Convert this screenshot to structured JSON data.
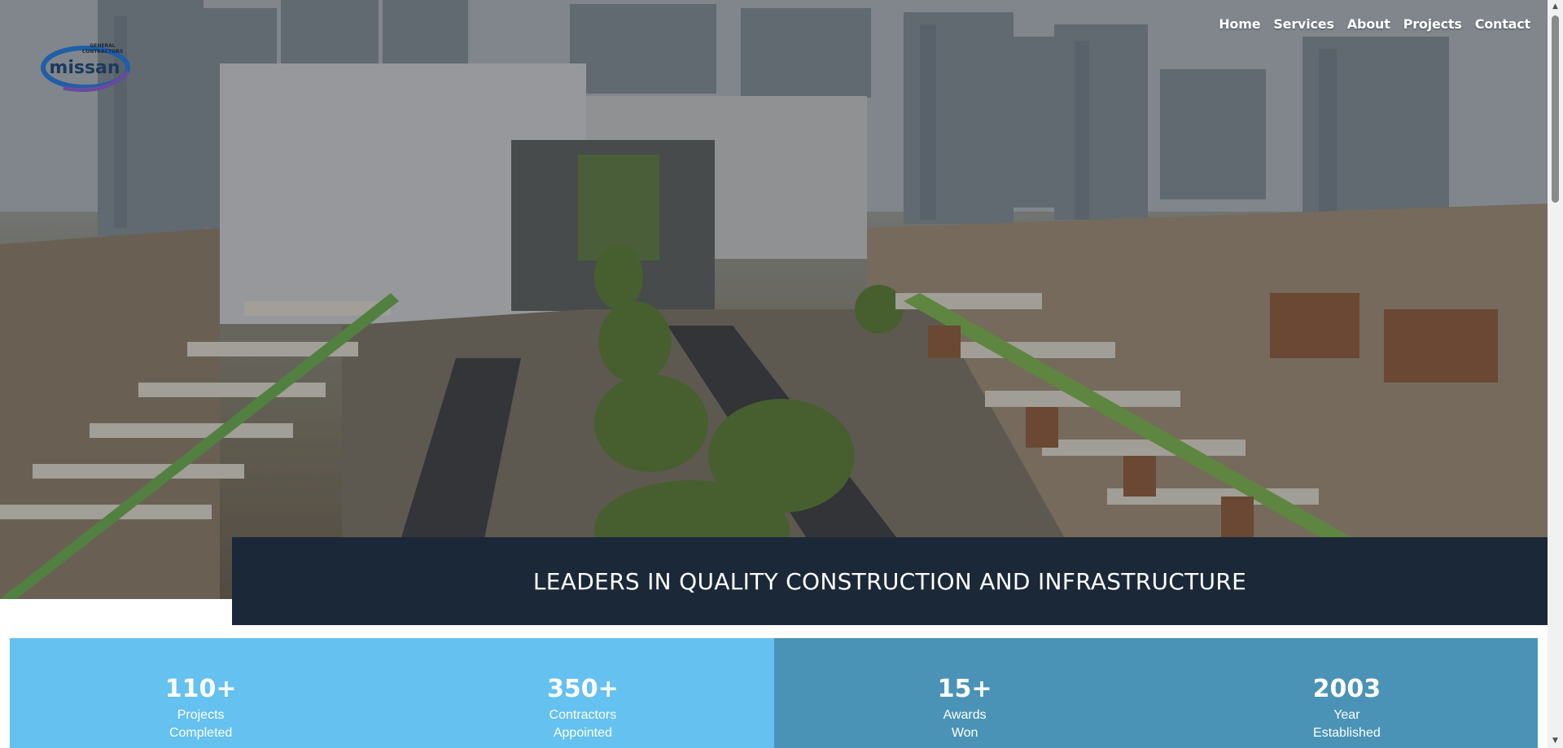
{
  "logo": {
    "top_text": "GENERAL",
    "sub_text": "CONTRACTORS",
    "name": "missan"
  },
  "nav": {
    "items": [
      {
        "label": "Home"
      },
      {
        "label": "Services"
      },
      {
        "label": "About"
      },
      {
        "label": "Projects"
      },
      {
        "label": "Contact"
      }
    ]
  },
  "banner": {
    "title": "LEADERS IN QUALITY CONSTRUCTION AND INFRASTRUCTURE"
  },
  "stats": [
    {
      "value": "110+",
      "label_line1": "Projects",
      "label_line2": "Completed"
    },
    {
      "value": "350+",
      "label_line1": "Contractors",
      "label_line2": "Appointed"
    },
    {
      "value": "15+",
      "label_line1": "Awards",
      "label_line2": "Won"
    },
    {
      "value": "2003",
      "label_line1": "Year",
      "label_line2": "Established"
    }
  ],
  "colors": {
    "banner_bg": "#1b2838",
    "stats_left_bg": "#65c1ef",
    "stats_right_bg": "#4a93b6",
    "logo_blue": "#1f5fa8",
    "logo_purple": "#6b4a9c"
  },
  "icons": {
    "scroll_up": "chevron-up-icon",
    "scroll_down": "chevron-down-icon"
  }
}
